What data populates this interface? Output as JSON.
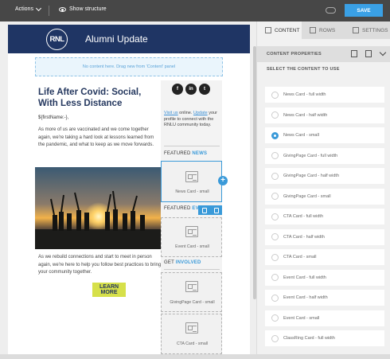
{
  "topbar": {
    "actions_label": "Actions",
    "show_structure_label": "Show structure",
    "save_label": "SAVE"
  },
  "email": {
    "header_logo": "RNL",
    "header_title": "Alumni Update",
    "dropzone_text": "No content here. Drag new from 'Content' panel",
    "headline": "Life After Covid: Social, With Less Distance",
    "greeting": "${firstName:-},",
    "body1": "As more of us are vaccinated and we come together again, we're taking a hard look at lessons learned from the pandemic, and what to keep as we move forwards.",
    "body2": "As we rebuild connections and start to meet in person again, we're here to help you follow best practices to bring your community together.",
    "cta_label": "LEARN MORE",
    "social": [
      "f",
      "in",
      "t"
    ],
    "visit_link": "Visit us",
    "visit_mid": "online.",
    "update_link": "Update",
    "visit_rest": "your profile to connect with the RNLU community today.",
    "sections": [
      {
        "prefix": "FEATURED",
        "highlight": "NEWS"
      },
      {
        "prefix": "FEATURED",
        "highlight": "EV"
      },
      {
        "prefix": "GET",
        "highlight": "INVOLVED"
      }
    ],
    "cards": [
      "News Card - small",
      "Event Card - small",
      "GivingPage Card - small",
      "CTA Card - small"
    ]
  },
  "panel": {
    "tabs": [
      "CONTENT",
      "ROWS",
      "SETTINGS"
    ],
    "props_title": "CONTENT PROPERTIES",
    "select_title": "SELECT THE CONTENT TO USE",
    "selected_index": 2,
    "options": [
      "News Card - full width",
      "News Card - half width",
      "News Card - small",
      "GivingPage Card - full width",
      "GivingPage Card - half width",
      "GivingPage Card - small",
      "CTA Card - full width",
      "CTA Card - half width",
      "CTA Card - small",
      "Event Card - full width",
      "Event Card - half width",
      "Event Card - small",
      "ClassRing Card - full width"
    ]
  }
}
